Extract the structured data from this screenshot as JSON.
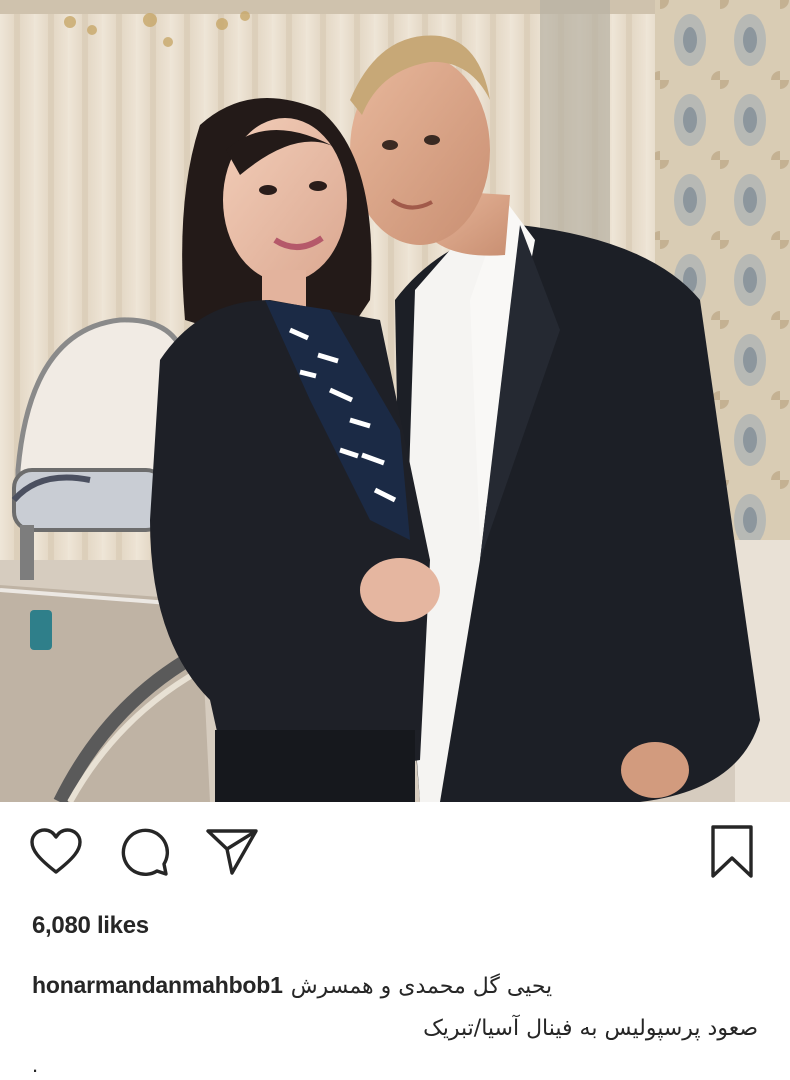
{
  "post": {
    "image_alt": "Couple posing in a furnished living room",
    "likes_count": "6,080",
    "likes_word": "likes",
    "username": "honarmandanmahbob1",
    "caption_line1": "یحیی گل محمدی و همسرش",
    "caption_line2": "صعود پرسپولیس به فینال آسیا/تبریک",
    "caption_line3": "."
  },
  "actions": {
    "like_icon": "heart-outline-icon",
    "comment_icon": "comment-bubble-icon",
    "share_icon": "paper-plane-icon",
    "save_icon": "bookmark-outline-icon"
  },
  "colors": {
    "text": "#262626",
    "background": "#ffffff"
  }
}
